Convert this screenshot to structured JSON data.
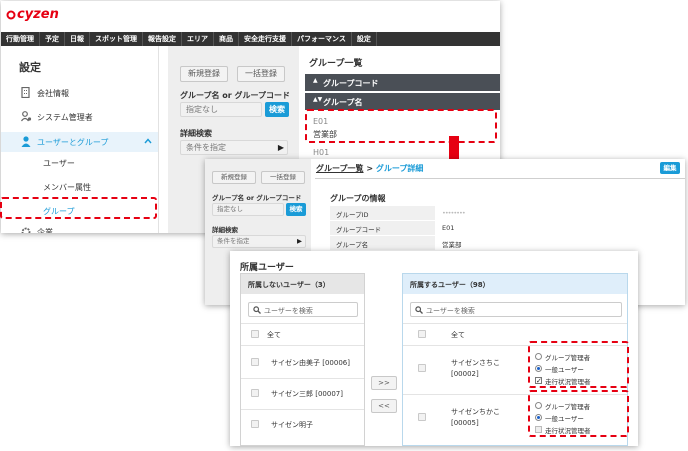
{
  "brand": {
    "logo": "cyzen"
  },
  "nav": [
    "行動管理",
    "予定",
    "日報",
    "スポット管理",
    "報告設定",
    "エリア",
    "商品",
    "安全走行支援",
    "パフォーマンス",
    "設定"
  ],
  "sidebar": {
    "title": "設定",
    "items": [
      {
        "label": "会社情報",
        "icon": "building-icon"
      },
      {
        "label": "システム管理者",
        "icon": "admin-user-icon"
      },
      {
        "label": "ユーザーとグループ",
        "icon": "person-icon"
      }
    ],
    "sub_items": [
      "ユーザー",
      "メンバー属性",
      "グループ"
    ],
    "more": "企業"
  },
  "filter_panel": {
    "new_label": "新規登録",
    "bulk_label": "一括登録",
    "search_label": "グループ名 or グループコード",
    "search_placeholder": "指定なし",
    "search_button": "検索",
    "detail_label": "詳細検索",
    "detail_value": "条件を指定"
  },
  "group_list": {
    "title": "グループ一覧",
    "col1": "グループコード",
    "col2": "グループ名",
    "rows": [
      {
        "code": "E01",
        "name": "営業部"
      },
      {
        "code": "H01",
        "name": ""
      }
    ]
  },
  "detail": {
    "breadcrumb_link": "グループ一覧",
    "breadcrumb_sep": ">",
    "breadcrumb_current": "グループ詳細",
    "edit_label": "編集",
    "new_label": "新規登録",
    "bulk_label": "一括登録",
    "search_label": "グループ名 or グループコード",
    "search_placeholder": "指定なし",
    "search_button": "検索",
    "detail_label": "詳細検索",
    "detail_value": "条件を指定",
    "info_title": "グループの情報",
    "fields": [
      {
        "label": "グループID",
        "value": "••••••••"
      },
      {
        "label": "グループコード",
        "value": "E01"
      },
      {
        "label": "グループ名",
        "value": "営業部"
      }
    ]
  },
  "members": {
    "title": "所属ユーザー",
    "non_title": "所属しないユーザー（3）",
    "in_title": "所属するユーザー（98）",
    "search_placeholder": "ユーザーを検索",
    "all_label": "全て",
    "add_button": ">>",
    "remove_button": "<<",
    "non_users": [
      "サイゼン由美子 [00006]",
      "サイゼン三郎 [00007]",
      "サイゼン明子"
    ],
    "in_users": [
      {
        "name": "サイゼンさちこ",
        "code": "[00002]",
        "roles": [
          "グループ管理者",
          "一般ユーザー",
          "走行状況管理者"
        ],
        "role_selected": 1,
        "driving_manager": true
      },
      {
        "name": "サイゼンちかこ",
        "code": "[00005]",
        "roles": [
          "グループ管理者",
          "一般ユーザー",
          "走行状況管理者"
        ],
        "role_selected": 1,
        "driving_manager": false
      }
    ]
  },
  "colors": {
    "accent": "#1a9bd7",
    "highlight": "#e60012",
    "nav_bg": "#333333"
  }
}
